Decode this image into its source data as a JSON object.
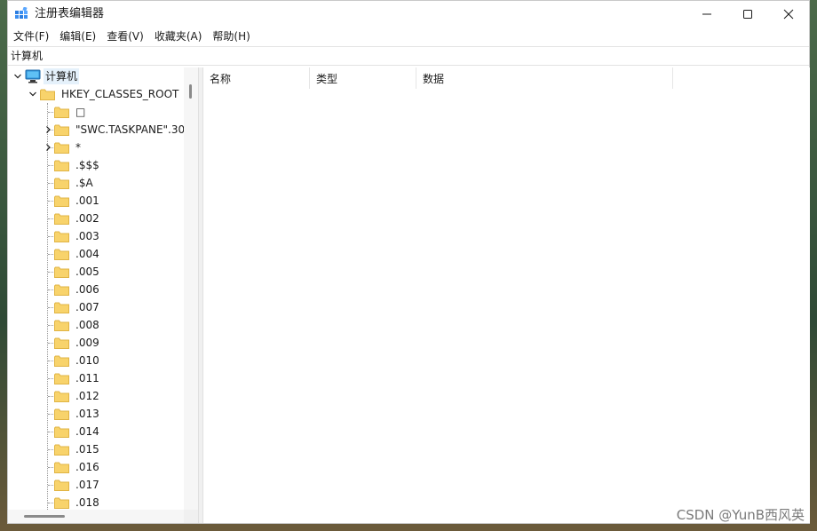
{
  "window": {
    "title": "注册表编辑器"
  },
  "menu": [
    "文件(F)",
    "编辑(E)",
    "查看(V)",
    "收藏夹(A)",
    "帮助(H)"
  ],
  "address": "计算机",
  "tree": {
    "root_label": "计算机",
    "hive_label": "HKEY_CLASSES_ROOT",
    "keys": [
      {
        "label": "□",
        "expandable": false
      },
      {
        "label": "\"SWC.TASKPANE\".30",
        "expandable": true
      },
      {
        "label": "*",
        "expandable": true
      },
      {
        "label": ".$$$",
        "expandable": false
      },
      {
        "label": ".$A",
        "expandable": false
      },
      {
        "label": ".001",
        "expandable": false
      },
      {
        "label": ".002",
        "expandable": false
      },
      {
        "label": ".003",
        "expandable": false
      },
      {
        "label": ".004",
        "expandable": false
      },
      {
        "label": ".005",
        "expandable": false
      },
      {
        "label": ".006",
        "expandable": false
      },
      {
        "label": ".007",
        "expandable": false
      },
      {
        "label": ".008",
        "expandable": false
      },
      {
        "label": ".009",
        "expandable": false
      },
      {
        "label": ".010",
        "expandable": false
      },
      {
        "label": ".011",
        "expandable": false
      },
      {
        "label": ".012",
        "expandable": false
      },
      {
        "label": ".013",
        "expandable": false
      },
      {
        "label": ".014",
        "expandable": false
      },
      {
        "label": ".015",
        "expandable": false
      },
      {
        "label": ".016",
        "expandable": false
      },
      {
        "label": ".017",
        "expandable": false
      },
      {
        "label": ".018",
        "expandable": false
      }
    ]
  },
  "columns": [
    "名称",
    "类型",
    "数据"
  ],
  "watermark": "CSDN @YunB西风英",
  "colors": {
    "folder": "#f8d36b",
    "folder_edge": "#e0b444",
    "selection": "#e5f1fb"
  }
}
